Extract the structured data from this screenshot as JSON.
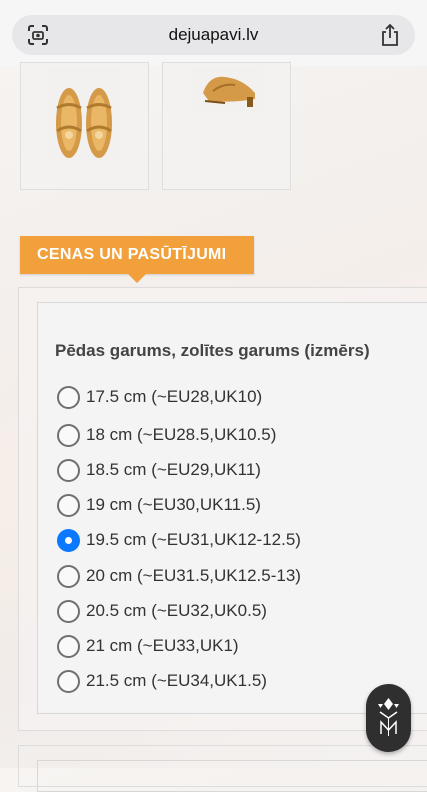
{
  "browser": {
    "url": "dejuapavi.lv",
    "left_icon": "camera-scan-icon",
    "right_icon": "share-icon"
  },
  "thumbnails": [
    {
      "name": "dance-shoe-front-view"
    },
    {
      "name": "dance-shoe-side-view"
    }
  ],
  "section": {
    "header": "CENAS UN PASŪTĪJUMI",
    "size_title": "Pēdas garums, zolītes garums (izmērs)",
    "options": [
      {
        "label": "17.5 cm (~EU28,UK10)",
        "checked": false
      },
      {
        "label": "18 cm (~EU28.5,UK10.5)",
        "checked": false
      },
      {
        "label": "18.5 cm (~EU29,UK11)",
        "checked": false
      },
      {
        "label": "19 cm (~EU30,UK11.5)",
        "checked": false
      },
      {
        "label": "19.5 cm (~EU31,UK12-12.5)",
        "checked": true
      },
      {
        "label": "20 cm (~EU31.5,UK12.5-13)",
        "checked": false
      },
      {
        "label": "20.5 cm (~EU32,UK0.5)",
        "checked": false
      },
      {
        "label": "21 cm (~EU33,UK1)",
        "checked": false
      },
      {
        "label": "21.5 cm (~EU34,UK1.5)",
        "checked": false
      }
    ]
  },
  "colors": {
    "accent": "#f2a03b",
    "radio_selected": "#0a78ff"
  }
}
